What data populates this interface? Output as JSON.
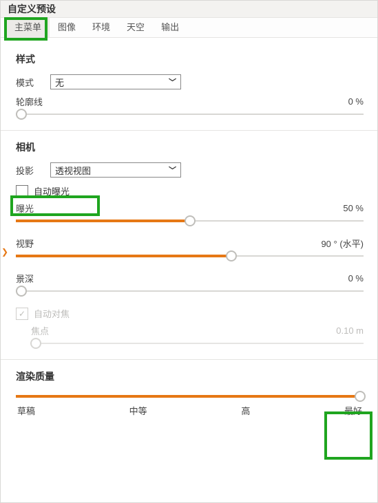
{
  "title": "自定义预设",
  "tabs": {
    "main": "主菜单",
    "image": "图像",
    "env": "环境",
    "sky": "天空",
    "output": "输出"
  },
  "style": {
    "section": "样式",
    "mode_label": "模式",
    "mode_value": "无",
    "outline_label": "轮廓线",
    "outline_value": "0 %"
  },
  "camera": {
    "section": "相机",
    "proj_label": "投影",
    "proj_value": "透视视图",
    "auto_exposure_label": "自动曝光",
    "auto_exposure_checked": false,
    "exposure_label": "曝光",
    "exposure_value": "50 %",
    "fov_label": "视野",
    "fov_value": "90 ° (水平)",
    "dof_label": "景深",
    "dof_value": "0 %",
    "autofocus_label": "自动对焦",
    "autofocus_checked": true,
    "focus_label": "焦点",
    "focus_value": "0.10  m"
  },
  "quality": {
    "section": "渲染质量",
    "labels": [
      "草稿",
      "中等",
      "高",
      "最好"
    ]
  }
}
